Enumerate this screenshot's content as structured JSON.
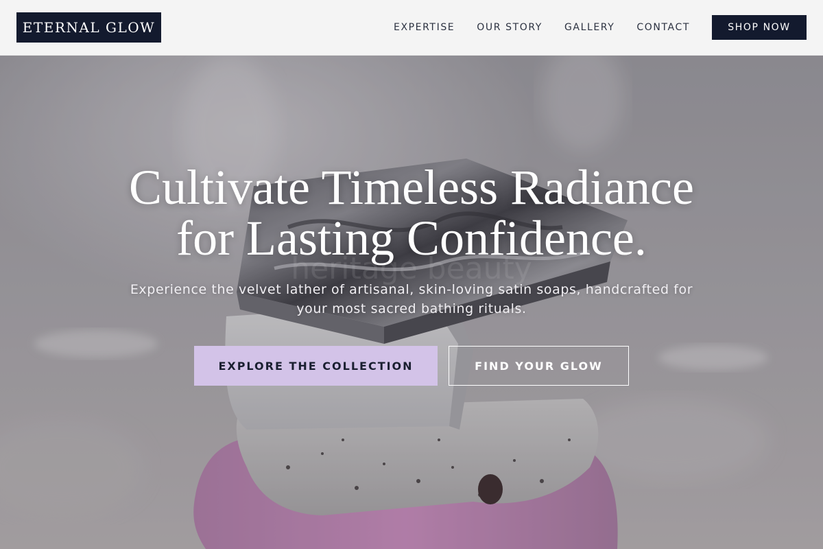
{
  "brand": {
    "logo_text": "ETERNAL GLOW"
  },
  "nav": {
    "items": [
      {
        "label": "EXPERTISE"
      },
      {
        "label": "OUR STORY"
      },
      {
        "label": "GALLERY"
      },
      {
        "label": "CONTACT"
      }
    ],
    "cta_label": "SHOP NOW"
  },
  "hero": {
    "title_line1": "Cultivate Timeless Radiance",
    "title_line2": "for Lasting Confidence.",
    "subtitle": "Experience the velvet lather of artisanal, skin-loving satin soaps, handcrafted for your most sacred bathing rituals.",
    "primary_button": "EXPLORE THE COLLECTION",
    "secondary_button": "FIND YOUR GLOW",
    "image_subject": "stacked artisanal soap bars"
  },
  "colors": {
    "navy": "#131a2e",
    "lavender": "#d3c3e8",
    "header_bg": "#f4f4f4",
    "white": "#ffffff"
  }
}
